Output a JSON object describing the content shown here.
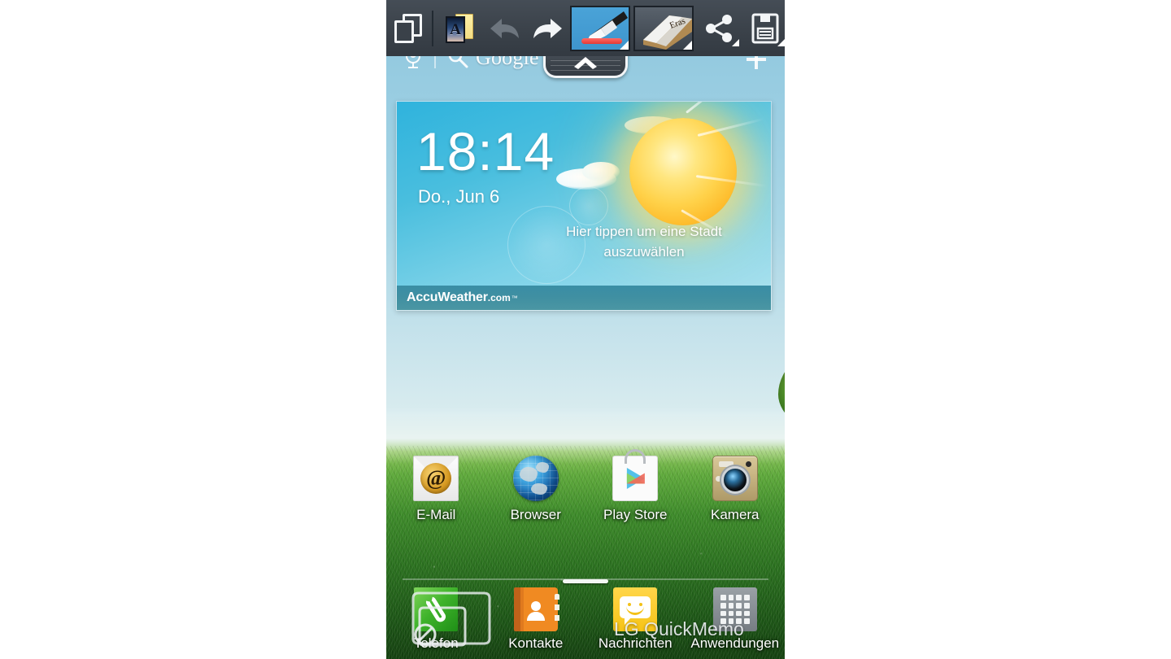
{
  "app": {
    "name": "LG QuickMemo",
    "watermark": "LG QuickMemo"
  },
  "toolbar": {
    "background_color": "#3c434b",
    "items": [
      {
        "name": "pages",
        "label": "Seiten",
        "icon": "pages-icon",
        "state": "enabled"
      },
      {
        "name": "template",
        "label": "Hintergrund",
        "icon": "template-a-icon",
        "state": "enabled"
      },
      {
        "name": "undo",
        "label": "Rückgängig",
        "icon": "undo-arrow-icon",
        "state": "disabled"
      },
      {
        "name": "redo",
        "label": "Wiederholen",
        "icon": "redo-arrow-icon",
        "state": "enabled"
      },
      {
        "name": "pen",
        "label": "Stift",
        "icon": "pen-icon",
        "state": "selected",
        "stroke_color": "#e43a34"
      },
      {
        "name": "eraser",
        "label": "Radierer",
        "icon": "eraser-icon",
        "state": "enabled"
      },
      {
        "name": "share",
        "label": "Teilen",
        "icon": "share-icon",
        "state": "enabled"
      },
      {
        "name": "save",
        "label": "Speichern",
        "icon": "save-floppy-icon",
        "state": "enabled"
      }
    ]
  },
  "search": {
    "mic_icon": "microphone-icon",
    "search_icon": "magnifier-icon",
    "provider": "Google",
    "add_icon": "plus-icon"
  },
  "pull_tab": {
    "icon": "chevron-up-icon",
    "label": ""
  },
  "weather_widget": {
    "time": "18:14",
    "date": "Do., Jun 6",
    "hint": "Hier tippen um eine Stadt auszuwählen",
    "brand_primary": "AccuWeather",
    "brand_secondary": ".com",
    "brand_tm": "™",
    "condition_icon": "sun-icon",
    "sky_color": "#49bede",
    "brandbar_color": "#3f8fa2"
  },
  "apps": [
    {
      "label": "E-Mail",
      "icon": "email-icon"
    },
    {
      "label": "Browser",
      "icon": "globe-icon"
    },
    {
      "label": "Play Store",
      "icon": "play-store-icon"
    },
    {
      "label": "Kamera",
      "icon": "camera-icon"
    }
  ],
  "page_indicator": {
    "pages": 1,
    "current": 1
  },
  "dock": [
    {
      "label": "Telefon",
      "icon": "phone-icon",
      "overlay": "no-entry-phone-icon"
    },
    {
      "label": "Kontakte",
      "icon": "contacts-icon"
    },
    {
      "label": "Nachrichten",
      "icon": "messages-icon"
    },
    {
      "label": "Anwendungen",
      "icon": "app-drawer-icon"
    }
  ],
  "colors": {
    "accent": "#49bede",
    "toolbar": "#3c434b",
    "pen_stroke": "#e43a34"
  }
}
